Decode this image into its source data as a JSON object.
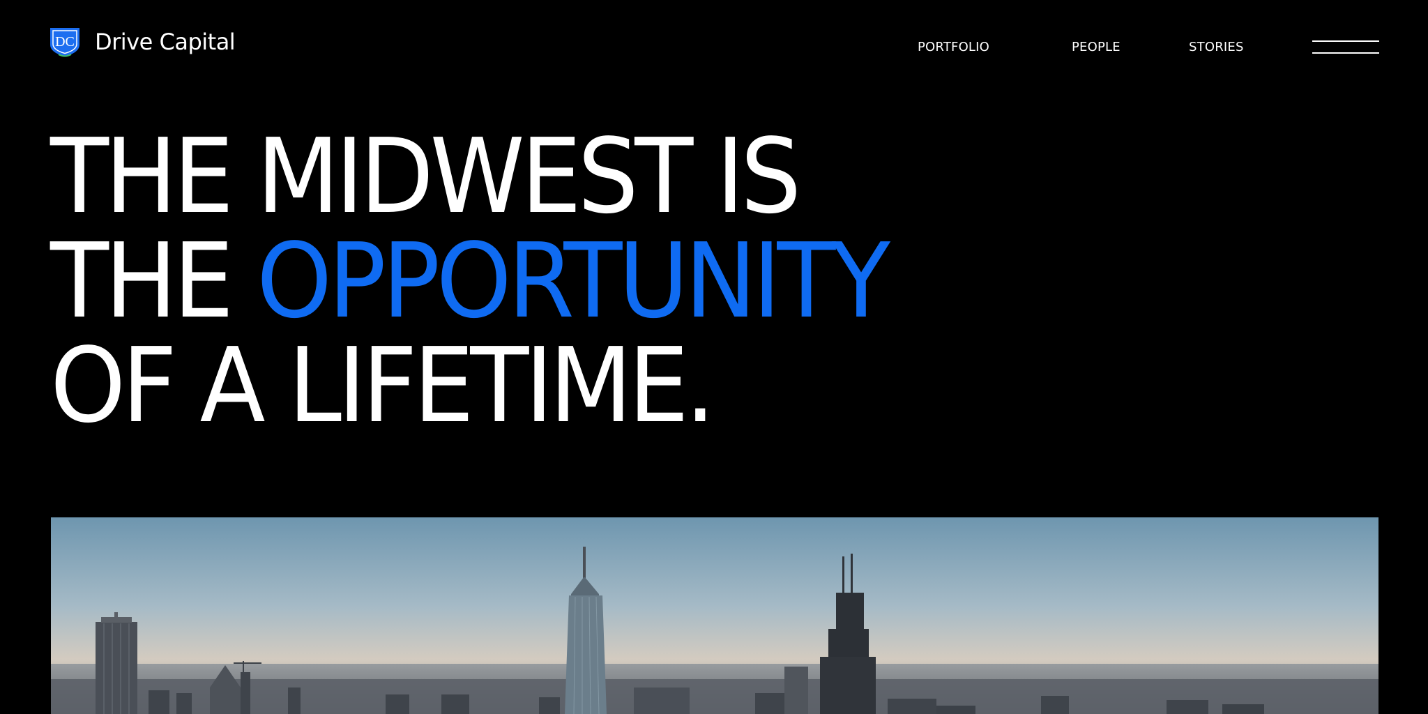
{
  "brand": {
    "logo_monogram": "DC",
    "name": "Drive Capital"
  },
  "nav": {
    "items": [
      {
        "label": "PORTFOLIO"
      },
      {
        "label": "PEOPLE"
      },
      {
        "label": "STORIES"
      }
    ],
    "menu_icon": "hamburger-menu-icon"
  },
  "hero": {
    "line1": "THE MIDWEST IS",
    "line2_prefix": "THE ",
    "line2_accent": "OPPORTUNITY",
    "line3": "OF A LIFETIME."
  },
  "colors": {
    "background": "#000000",
    "text": "#ffffff",
    "accent": "#0f6bf2"
  },
  "image": {
    "subject": "city-skyline-photo"
  }
}
